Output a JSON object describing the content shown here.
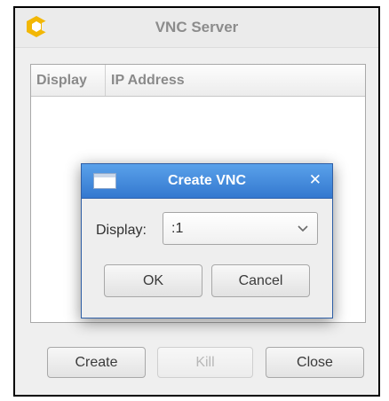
{
  "main_window": {
    "title": "VNC Server",
    "logo_icon": "app-logo-icon",
    "list": {
      "columns": [
        "Display",
        "IP Address"
      ],
      "rows": []
    },
    "buttons": {
      "create": "Create",
      "kill": "Kill",
      "close": "Close"
    },
    "kill_enabled": false
  },
  "dialog": {
    "title": "Create VNC",
    "close_glyph": "✕",
    "display_label": "Display:",
    "display_value": ":1",
    "ok": "OK",
    "cancel": "Cancel"
  },
  "colors": {
    "dialog_titlebar": "#3a7fd4",
    "logo_yellow": "#f2b705"
  }
}
